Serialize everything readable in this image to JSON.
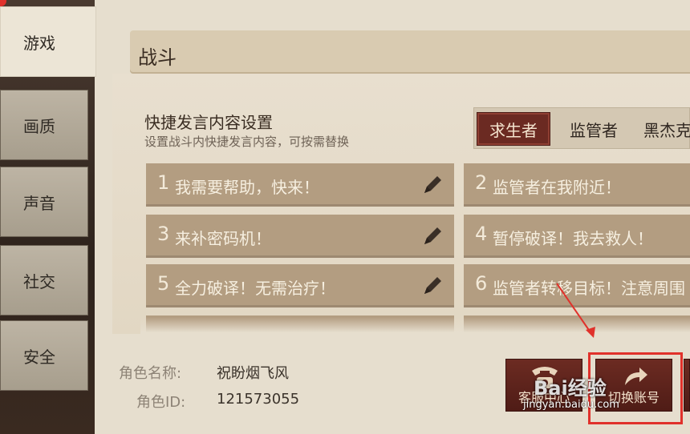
{
  "sidebar": {
    "items": [
      {
        "label": "游戏",
        "active": true
      },
      {
        "label": "画质",
        "active": false
      },
      {
        "label": "声音",
        "active": false
      },
      {
        "label": "社交",
        "active": false
      },
      {
        "label": "安全",
        "active": false
      }
    ]
  },
  "header": {
    "title": "战斗"
  },
  "quick_chat": {
    "title": "快捷发言内容设置",
    "subtitle": "设置战斗内快捷发言内容，可按需替换",
    "roles": [
      "求生者",
      "监管者",
      "黑杰克"
    ],
    "active_role": "求生者",
    "phrases": [
      {
        "num": "1",
        "text": "我需要帮助，快来！"
      },
      {
        "num": "2",
        "text": "监管者在我附近！"
      },
      {
        "num": "3",
        "text": "来补密码机！"
      },
      {
        "num": "4",
        "text": "暂停破译！我去救人！"
      },
      {
        "num": "5",
        "text": "全力破译！无需治疗！"
      },
      {
        "num": "6",
        "text": "监管者转移目标！注意周围"
      }
    ]
  },
  "account": {
    "name_label": "角色名称:",
    "name_value": "祝盼烟飞风",
    "id_label": "角色ID:",
    "id_value": "121573055"
  },
  "buttons": {
    "customer_service": "客服中心",
    "switch_account": "切换账号"
  },
  "watermark": {
    "logo": "Bai经验",
    "url": "jingyan.baidu.com"
  },
  "colors": {
    "accent": "#6b2a22",
    "card": "#b39d81",
    "highlight": "#e0312b"
  }
}
